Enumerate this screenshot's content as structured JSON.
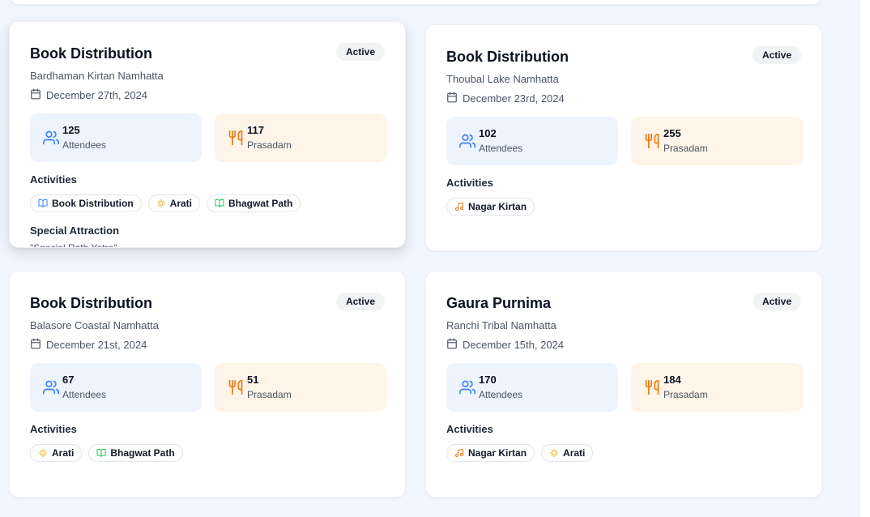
{
  "cards": [
    {
      "title": "Book Distribution",
      "badge": "Active",
      "location": "Bardhaman Kirtan Namhatta",
      "date": "December 27th, 2024",
      "attendees": {
        "value": "125",
        "label": "Attendees"
      },
      "prasadam": {
        "value": "117",
        "label": "Prasadam"
      },
      "activities_label": "Activities",
      "activities": [
        "Book Distribution",
        "Arati",
        "Bhagwat Path"
      ],
      "special_label": "Special Attraction",
      "special_text": "\"Special Rath Yatra\""
    },
    {
      "title": "Book Distribution",
      "badge": "Active",
      "location": "Thoubal Lake Namhatta",
      "date": "December 23rd, 2024",
      "attendees": {
        "value": "102",
        "label": "Attendees"
      },
      "prasadam": {
        "value": "255",
        "label": "Prasadam"
      },
      "activities_label": "Activities",
      "activities": [
        "Nagar Kirtan"
      ]
    },
    {
      "title": "Book Distribution",
      "badge": "Active",
      "location": "Balasore Coastal Namhatta",
      "date": "December 21st, 2024",
      "attendees": {
        "value": "67",
        "label": "Attendees"
      },
      "prasadam": {
        "value": "51",
        "label": "Prasadam"
      },
      "activities_label": "Activities",
      "activities": [
        "Arati",
        "Bhagwat Path"
      ]
    },
    {
      "title": "Gaura Purnima",
      "badge": "Active",
      "location": "Ranchi Tribal Namhatta",
      "date": "December 15th, 2024",
      "attendees": {
        "value": "170",
        "label": "Attendees"
      },
      "prasadam": {
        "value": "184",
        "label": "Prasadam"
      },
      "activities_label": "Activities",
      "activities": [
        "Nagar Kirtan",
        "Arati"
      ]
    }
  ],
  "icons": {
    "calendar": "calendar-icon",
    "attendees": "users-icon",
    "prasadam": "utensils-icon",
    "Book Distribution": "book-icon",
    "Bhagwat Path": "book-open-icon",
    "Arati": "sparkles-icon",
    "Nagar Kirtan": "music-icon"
  },
  "colors": {
    "attendees_bg": "#edf4fe",
    "attendees_icon": "#3b82f6",
    "prasadam_bg": "#fef4e8",
    "prasadam_icon": "#ea7a12",
    "arati_icon": "#eab308",
    "bhagwat_icon": "#22c55e",
    "nagar_icon": "#ea7a12"
  }
}
